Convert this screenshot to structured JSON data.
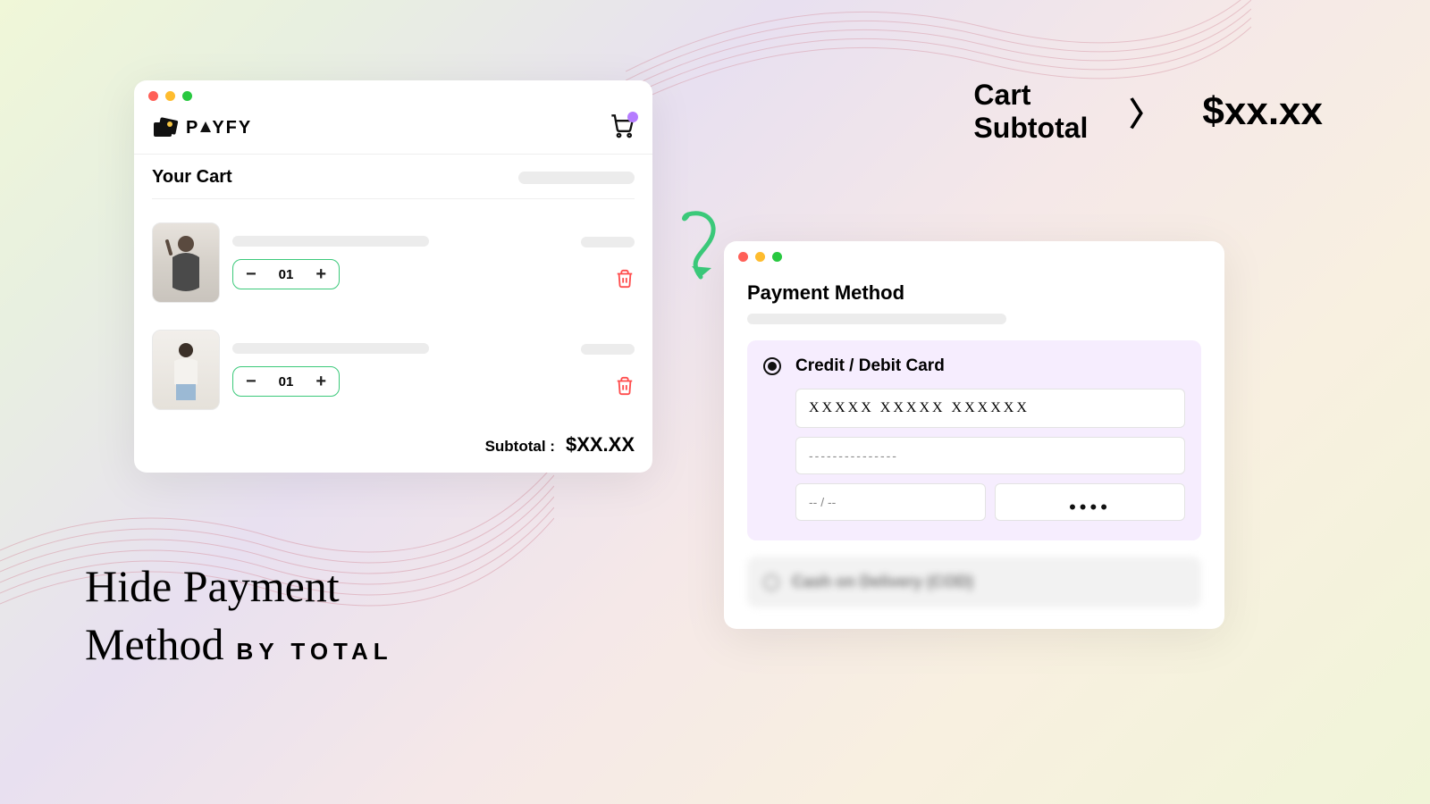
{
  "brand": {
    "name_prefix": "P",
    "name_suffix": "YFY"
  },
  "cart": {
    "title": "Your Cart",
    "items": [
      {
        "qty": "01"
      },
      {
        "qty": "01"
      }
    ],
    "subtotal_label": "Subtotal :",
    "subtotal_value": "$XX.XX"
  },
  "payment": {
    "title": "Payment Method",
    "credit_label": "Credit / Debit Card",
    "card_number": "XXXXX XXXXX XXXXXX",
    "card_name": "---------------",
    "card_exp": "-- / --",
    "card_cvv": "••••",
    "hidden_method": "Cash on Delivery (COD)"
  },
  "condition": {
    "line1": "Cart",
    "line2": "Subtotal",
    "operator": "〉",
    "value": "$xx.xx"
  },
  "headline": {
    "line1": "Hide Payment",
    "line2a": "Method",
    "line2b": "BY TOTAL"
  }
}
